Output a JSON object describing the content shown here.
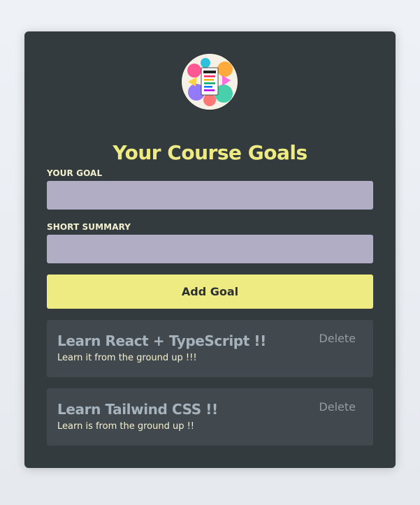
{
  "app": {
    "title": "Your Course Goals",
    "colors": {
      "accent": "#eeeb82",
      "panel": "#343b3e",
      "card": "#42494e",
      "input": "#b0adc4"
    },
    "logo": {
      "icon": "goals-image"
    }
  },
  "form": {
    "goal_label": "YOUR GOAL",
    "goal_value": "",
    "summary_label": "SHORT SUMMARY",
    "summary_value": "",
    "add_label": "Add Goal"
  },
  "goals": [
    {
      "title": "Learn React + TypeScript !!",
      "summary": "Learn it from the ground up !!!",
      "delete_label": "Delete"
    },
    {
      "title": "Learn Tailwind CSS !!",
      "summary": "Learn is from the ground up !!",
      "delete_label": "Delete"
    }
  ]
}
